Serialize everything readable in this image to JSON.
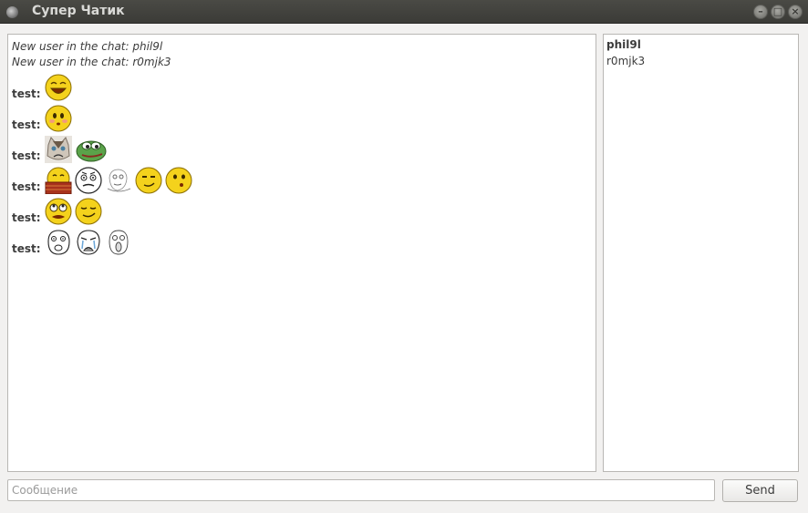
{
  "window": {
    "title": "Супер Чатик"
  },
  "chat": {
    "system_messages": [
      "New user in the chat: phil9l",
      "New user in the chat: r0mjk3"
    ],
    "messages": [
      {
        "author": "test:",
        "emojis": [
          "laughing-smiley-icon"
        ]
      },
      {
        "author": "test:",
        "emojis": [
          "blushing-smiley-icon"
        ]
      },
      {
        "author": "test:",
        "emojis": [
          "grumpy-cat-icon",
          "pepe-frog-icon"
        ]
      },
      {
        "author": "test:",
        "emojis": [
          "scarf-smiley-icon",
          "me-gusta-face-icon",
          "sketch-face-icon",
          "smirk-smiley-icon",
          "whistling-smiley-icon"
        ]
      },
      {
        "author": "test:",
        "emojis": [
          "eye-roll-smiley-icon",
          "smug-smiley-icon"
        ]
      },
      {
        "author": "test:",
        "emojis": [
          "rage-face-icon",
          "crying-rage-face-icon",
          "ohgod-face-icon"
        ]
      }
    ]
  },
  "users": [
    "phil9l",
    "r0mjk3"
  ],
  "input": {
    "placeholder": "Сообщение"
  },
  "send_button": {
    "label": "Send"
  },
  "colors": {
    "titlebar": "#3c3b37",
    "background": "#f2f1f0",
    "emoji_yellow": "#f2d21a"
  }
}
